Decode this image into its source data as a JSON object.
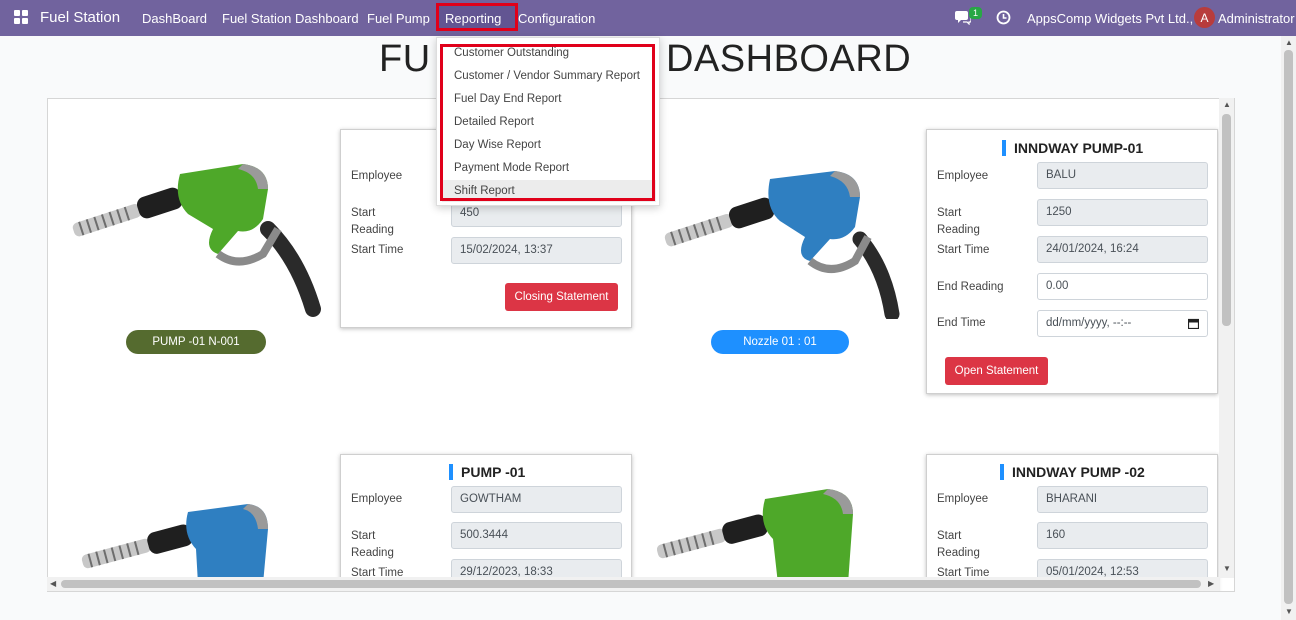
{
  "navbar": {
    "brand": "Fuel Station",
    "items": [
      "DashBoard",
      "Fuel Station Dashboard",
      "Fuel Pump",
      "Reporting",
      "Configuration"
    ],
    "message_count": "1",
    "company": "AppsComp Widgets Pvt Ltd.,",
    "user_initial": "A",
    "user": "Administrator",
    "color": "#71639e"
  },
  "page": {
    "title_left": "FU",
    "title_right": "DASHBOARD"
  },
  "reporting_menu": {
    "items": [
      "Customer Outstanding",
      "Customer / Vendor Summary Report",
      "Fuel Day End Report",
      "Detailed Report",
      "Day Wise Report",
      "Payment Mode Report",
      "Shift Report"
    ]
  },
  "pumps": [
    {
      "pill": "PUMP -01   N-001",
      "pill_color": "#556b2f",
      "nozzle_color": "green",
      "card": {
        "employee_label": "Employee",
        "start_reading_label_1": "Start",
        "start_reading_label_2": "Reading",
        "start_reading": "450",
        "start_time_label": "Start Time",
        "start_time": "15/02/2024, 13:37",
        "button": "Closing Statement"
      }
    },
    {
      "pill": "Nozzle 01 : 01",
      "pill_color": "#1e90ff",
      "nozzle_color": "blue",
      "card": {
        "title": "INNDWAY PUMP-01",
        "employee_label": "Employee",
        "employee": "BALU",
        "start_reading_label_1": "Start",
        "start_reading_label_2": "Reading",
        "start_reading": "1250",
        "start_time_label": "Start Time",
        "start_time": "24/01/2024, 16:24",
        "end_reading_label": "End Reading",
        "end_reading": "0.00",
        "end_time_label": "End Time",
        "end_time_placeholder": "dd/mm/yyyy, --:--",
        "button": "Open Statement"
      }
    },
    {
      "nozzle_color": "blue",
      "card": {
        "title": "PUMP -01",
        "employee_label": "Employee",
        "employee": "GOWTHAM",
        "start_reading_label_1": "Start",
        "start_reading_label_2": "Reading",
        "start_reading": "500.3444",
        "start_time_label": "Start Time",
        "start_time": "29/12/2023, 18:33"
      }
    },
    {
      "nozzle_color": "green",
      "card": {
        "title": "INNDWAY PUMP -02",
        "employee_label": "Employee",
        "employee": "BHARANI",
        "start_reading_label_1": "Start",
        "start_reading_label_2": "Reading",
        "start_reading": "160",
        "start_time_label": "Start Time",
        "start_time": "05/01/2024, 12:53"
      }
    }
  ]
}
